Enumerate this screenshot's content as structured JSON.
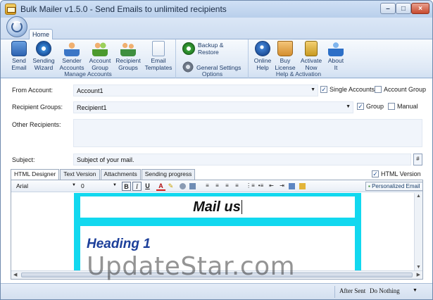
{
  "window": {
    "title": "Bulk Mailer v1.5.0 - Send Emails to unlimited recipients"
  },
  "ribbon": {
    "tab": "Home",
    "groups": {
      "manage": {
        "label": "Manage Accounts",
        "buttons": [
          "Send\nEmail",
          "Sending\nWizard",
          "Sender\nAccounts",
          "Account\nGroup",
          "Recipient\nGroups",
          "Email\nTemplates"
        ]
      },
      "options": {
        "label": "Options",
        "backup": "Backup &\nRestore",
        "settings": "General Settings"
      },
      "help": {
        "label": "Help & Activation",
        "buttons": [
          "Online\nHelp",
          "Buy\nLicense",
          "Activate\nNow",
          "About\nIt"
        ]
      }
    }
  },
  "form": {
    "from_label": "From Account:",
    "from_value": "Account1",
    "single_accounts": "Single Accounts",
    "account_group": "Account Group",
    "recipient_label": "Recipient Groups:",
    "recipient_value": "Recipient1",
    "group": "Group",
    "manual": "Manual",
    "other_label": "Other Recipients:",
    "subject_label": "Subject:",
    "subject_value": "Subject of your mail.",
    "subject_btn": "#"
  },
  "editor": {
    "tabs": [
      "HTML Designer",
      "Text Version",
      "Attachments",
      "Sending progress"
    ],
    "html_version": "HTML Version",
    "font": "Arial",
    "size": "0",
    "bold": "B",
    "italic": "I",
    "underline": "U",
    "font_color": "A",
    "personalized": "Personalized Email",
    "mail_heading": "Mail us",
    "heading1": "Heading 1"
  },
  "status": {
    "after_sent_label": "After Sent",
    "after_sent_value": "Do Nothing"
  },
  "watermark": "UpdateStar.com",
  "colors": {
    "teal": "#12d8ef",
    "heading": "#1c3f9a"
  }
}
